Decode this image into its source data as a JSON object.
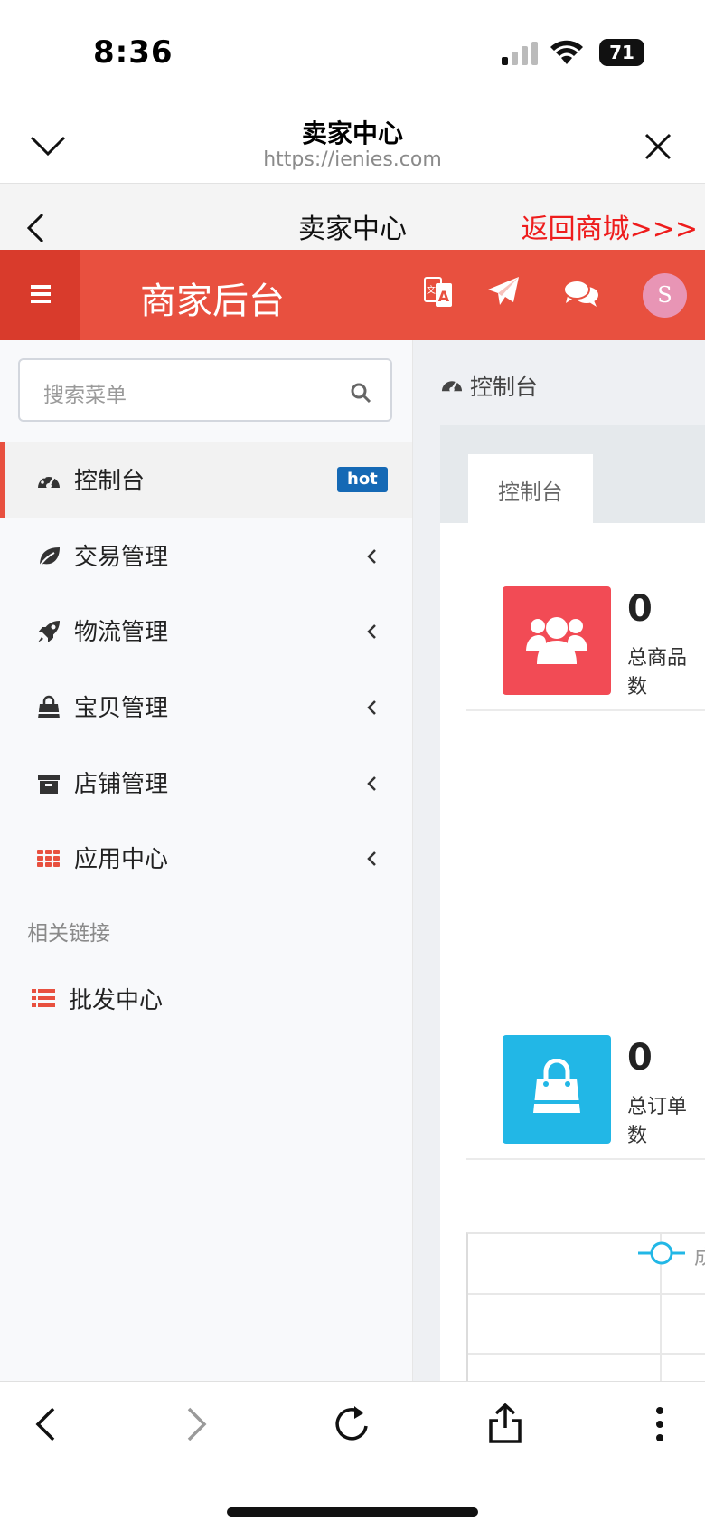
{
  "status_bar": {
    "time": "8:36",
    "battery": "71"
  },
  "browser": {
    "title": "卖家中心",
    "url": "https://ienies.com"
  },
  "subheader": {
    "title": "卖家中心",
    "return_link": "返回商城>>>"
  },
  "header": {
    "brand": "商家后台",
    "avatar_letter": "S",
    "colors": {
      "primary": "#e8503f",
      "menu_button": "#d93b2c"
    }
  },
  "sidebar": {
    "search_placeholder": "搜索菜单",
    "items": [
      {
        "label": "控制台",
        "icon": "dashboard-icon",
        "badge": "hot",
        "active": true
      },
      {
        "label": "交易管理",
        "icon": "leaf-icon"
      },
      {
        "label": "物流管理",
        "icon": "rocket-icon"
      },
      {
        "label": "宝贝管理",
        "icon": "shopping-bag-icon"
      },
      {
        "label": "店铺管理",
        "icon": "archive-icon"
      },
      {
        "label": "应用中心",
        "icon": "grid-icon"
      }
    ],
    "section_label": "相关链接",
    "links": [
      {
        "label": "批发中心",
        "icon": "list-icon"
      }
    ]
  },
  "content": {
    "breadcrumb": "控制台",
    "tab": "控制台",
    "stats": [
      {
        "value": "0",
        "label": "总商品数",
        "icon": "users-icon",
        "color": "#f24b55"
      },
      {
        "value": "0",
        "label": "总订单数",
        "icon": "shopping-bag-icon",
        "color": "#22b7e6"
      }
    ],
    "chart_legend_partial": "成"
  }
}
